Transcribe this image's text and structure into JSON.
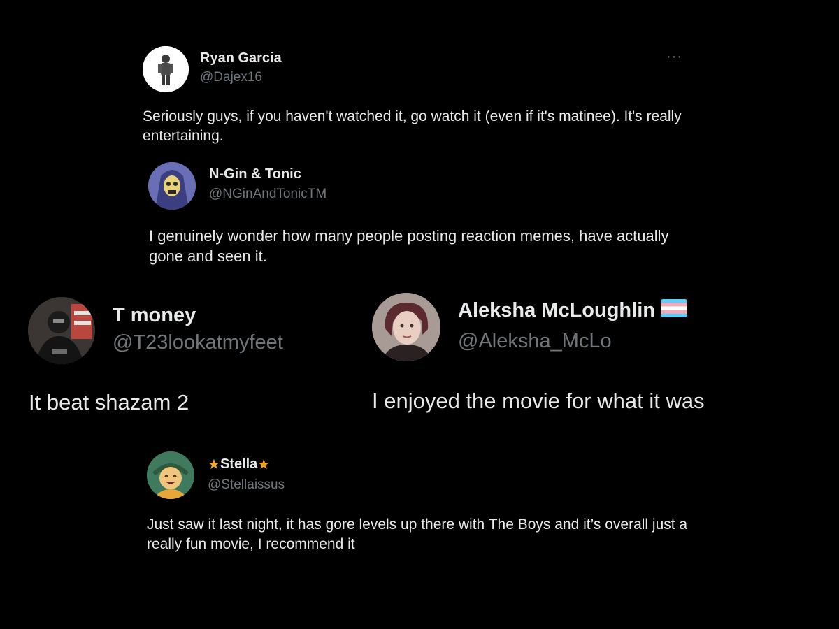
{
  "tweets": [
    {
      "name": "Ryan Garcia",
      "handle": "@Dajex16",
      "text": "Seriously guys, if you haven't watched it, go watch it (even if it's matinee). It's really entertaining.",
      "avatar_icon": "soldier-figure-avatar-icon",
      "more_icon": "more-options-icon",
      "more_glyph": "···"
    },
    {
      "name": "N-Gin & Tonic",
      "handle": "@NGinAndTonicTM",
      "text": "I genuinely wonder how many people posting reaction memes, have actually gone and seen it.",
      "avatar_icon": "hooded-skull-avatar-icon"
    },
    {
      "name": "T money",
      "handle": "@T23lookatmyfeet",
      "text": "It beat shazam 2",
      "avatar_icon": "masked-person-avatar-icon"
    },
    {
      "name": "Aleksha McLoughlin",
      "handle": "@Aleksha_McLo",
      "text": "I enjoyed the movie for what it was",
      "avatar_icon": "person-photo-avatar-icon",
      "name_emoji": "transgender-flag-icon"
    },
    {
      "name": "Stella",
      "name_prefix_glyph": "★",
      "name_suffix_glyph": "★",
      "handle": "@Stellaissus",
      "text": "Just saw it last night, it has gore levels up there with The Boys and it’s overall just a really fun movie, I recommend it",
      "avatar_icon": "cartoon-character-avatar-icon"
    }
  ],
  "colors": {
    "background": "#000000",
    "name_text": "#e7e9ea",
    "handle_text": "#71767b",
    "body_text": "#e7e9ea",
    "star": "#f6a623",
    "flag_blue": "#5bcefa",
    "flag_pink": "#f5a9b8",
    "flag_white": "#ffffff"
  }
}
